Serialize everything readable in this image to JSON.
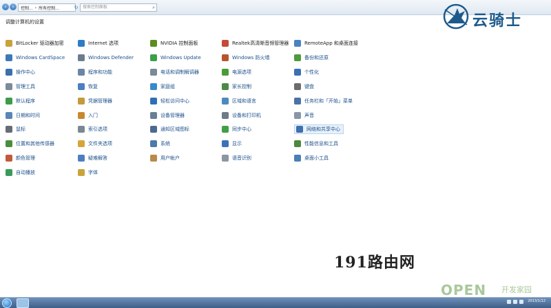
{
  "address": {
    "crumbs": [
      "控制...",
      "所有控制..."
    ],
    "search_placeholder": "搜索控制面板"
  },
  "logo": {
    "text": "云骑士"
  },
  "page_title": "调整计算机的设置",
  "items": [
    {
      "label": "BitLocker 驱动器加密",
      "icon": "bitlocker-icon",
      "color": "#c8a23a",
      "style": "black"
    },
    {
      "label": "Internet 选项",
      "icon": "internet-options-icon",
      "color": "#2e7cc6",
      "style": "black"
    },
    {
      "label": "NVIDIA 控制面板",
      "icon": "nvidia-icon",
      "color": "#5a8d1e",
      "style": "black"
    },
    {
      "label": "Realtek高清晰音频管理器",
      "icon": "realtek-audio-icon",
      "color": "#c54a3a",
      "style": "black"
    },
    {
      "label": "RemoteApp 和桌面连接",
      "icon": "remoteapp-icon",
      "color": "#4a82c2",
      "style": "black"
    },
    {
      "label": "Windows CardSpace",
      "icon": "cardspace-icon",
      "color": "#3f78b8",
      "style": "blue"
    },
    {
      "label": "Windows Defender",
      "icon": "defender-icon",
      "color": "#6a7d8f",
      "style": "blue"
    },
    {
      "label": "Windows Update",
      "icon": "windows-update-icon",
      "color": "#3aa04a",
      "style": "blue"
    },
    {
      "label": "Windows 防火墙",
      "icon": "firewall-icon",
      "color": "#b8542d",
      "style": "blue"
    },
    {
      "label": "备份和还原",
      "icon": "backup-icon",
      "color": "#4f9a3c",
      "style": "blue"
    },
    {
      "label": "操作中心",
      "icon": "action-center-icon",
      "color": "#3a6fb0",
      "style": "blue"
    },
    {
      "label": "程序和功能",
      "icon": "programs-icon",
      "color": "#6c84a6",
      "style": "blue"
    },
    {
      "label": "电话和调制解调器",
      "icon": "phone-modem-icon",
      "color": "#7a8a96",
      "style": "blue"
    },
    {
      "label": "电源选项",
      "icon": "power-options-icon",
      "color": "#4a9c3a",
      "style": "blue"
    },
    {
      "label": "个性化",
      "icon": "personalization-icon",
      "color": "#3c6fb4",
      "style": "blue"
    },
    {
      "label": "管理工具",
      "icon": "admin-tools-icon",
      "color": "#7c8a99",
      "style": "blue"
    },
    {
      "label": "恢复",
      "icon": "recovery-icon",
      "color": "#4b7fbf",
      "style": "blue"
    },
    {
      "label": "家庭组",
      "icon": "homegroup-icon",
      "color": "#3a8ac8",
      "style": "blue"
    },
    {
      "label": "家长控制",
      "icon": "parental-control-icon",
      "color": "#4b8a46",
      "style": "blue"
    },
    {
      "label": "键盘",
      "icon": "keyboard-icon",
      "color": "#6c6c6c",
      "style": "blue"
    },
    {
      "label": "默认程序",
      "icon": "default-programs-icon",
      "color": "#3e9b4a",
      "style": "blue"
    },
    {
      "label": "凭据管理器",
      "icon": "credential-manager-icon",
      "color": "#c49a3a",
      "style": "blue"
    },
    {
      "label": "轻松访问中心",
      "icon": "ease-of-access-icon",
      "color": "#2f6fb8",
      "style": "blue"
    },
    {
      "label": "区域和语言",
      "icon": "region-language-icon",
      "color": "#4c8ac0",
      "style": "blue"
    },
    {
      "label": "任务栏和「开始」菜单",
      "icon": "taskbar-start-icon",
      "color": "#4a72a8",
      "style": "blue"
    },
    {
      "label": "日期和时间",
      "icon": "date-time-icon",
      "color": "#5a86b8",
      "style": "blue"
    },
    {
      "label": "入门",
      "icon": "getting-started-icon",
      "color": "#c9882f",
      "style": "blue"
    },
    {
      "label": "设备管理器",
      "icon": "device-manager-icon",
      "color": "#6a7f95",
      "style": "blue"
    },
    {
      "label": "设备和打印机",
      "icon": "devices-printers-icon",
      "color": "#6f7b86",
      "style": "blue"
    },
    {
      "label": "声音",
      "icon": "sound-icon",
      "color": "#8a96a4",
      "style": "blue"
    },
    {
      "label": "鼠标",
      "icon": "mouse-icon",
      "color": "#666c73",
      "style": "blue"
    },
    {
      "label": "索引选项",
      "icon": "indexing-icon",
      "color": "#7a8894",
      "style": "blue"
    },
    {
      "label": "通知区域图标",
      "icon": "notification-area-icon",
      "color": "#4c6a90",
      "style": "blue"
    },
    {
      "label": "同步中心",
      "icon": "sync-center-icon",
      "color": "#3fa046",
      "style": "blue"
    },
    {
      "label": "网络和共享中心",
      "icon": "network-sharing-icon",
      "color": "#3e6fb0",
      "style": "blue"
    },
    {
      "label": "位置和其他传感器",
      "icon": "location-sensors-icon",
      "color": "#4a8d3e",
      "style": "blue"
    },
    {
      "label": "文件夹选项",
      "icon": "folder-options-icon",
      "color": "#d4a63a",
      "style": "blue"
    },
    {
      "label": "系统",
      "icon": "system-icon",
      "color": "#4d79ad",
      "style": "blue"
    },
    {
      "label": "显示",
      "icon": "display-icon",
      "color": "#3c73b8",
      "style": "blue"
    },
    {
      "label": "性能信息和工具",
      "icon": "performance-icon",
      "color": "#4b8a3c",
      "style": "blue"
    },
    {
      "label": "颜色管理",
      "icon": "color-management-icon",
      "color": "#c25a3a",
      "style": "blue"
    },
    {
      "label": "疑难解答",
      "icon": "troubleshooting-icon",
      "color": "#4d7fc0",
      "style": "blue"
    },
    {
      "label": "用户帐户",
      "icon": "user-accounts-icon",
      "color": "#b98a4a",
      "style": "blue"
    },
    {
      "label": "语音识别",
      "icon": "speech-recognition-icon",
      "color": "#8a96a4",
      "style": "blue"
    },
    {
      "label": "桌面小工具",
      "icon": "desktop-gadgets-icon",
      "color": "#4a7fb8",
      "style": "blue"
    },
    {
      "label": "自动播放",
      "icon": "autoplay-icon",
      "color": "#3a9a5a",
      "style": "blue"
    },
    {
      "label": "字体",
      "icon": "fonts-icon",
      "color": "#c9a43a",
      "style": "blue"
    }
  ],
  "hover_index": 34,
  "watermark": {
    "site": "191路由网",
    "open": "OPEN",
    "open_sub": "开发家园"
  },
  "taskbar": {
    "time": "",
    "date": "2013/1/12"
  }
}
